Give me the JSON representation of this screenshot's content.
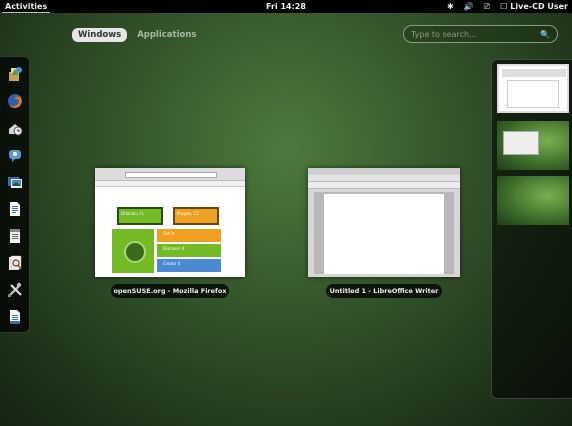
{
  "topbar": {
    "activities": "Activities",
    "clock": "Fri 14:28",
    "user": "Live-CD User"
  },
  "view_tabs": {
    "windows": "Windows",
    "applications": "Applications"
  },
  "search": {
    "placeholder": "Type to search..."
  },
  "dash": {
    "items": [
      "install-icon",
      "firefox-icon",
      "disk-backup-icon",
      "empathy-chat-icon",
      "shotwell-photos-icon",
      "writer-document-icon",
      "text-editor-icon",
      "document-viewer-icon",
      "system-tools-icon",
      "text-file-icon"
    ]
  },
  "windows": {
    "firefox": {
      "label": "openSUSE.org - Mozilla Firefox",
      "site_items": [
        "Orlando, FL",
        "Prague, CZ",
        "Get it",
        "Discover it",
        "Create it"
      ]
    },
    "writer": {
      "label": "Untitled 1 - LibreOffice Writer"
    }
  },
  "workspaces": {
    "count": 3
  },
  "colors": {
    "desktop_green": "#35562c",
    "opensuse_green": "#73ba25",
    "opensuse_orange": "#f0a020"
  }
}
